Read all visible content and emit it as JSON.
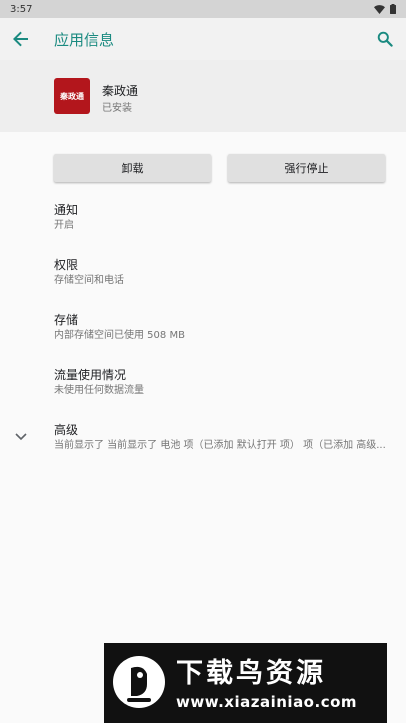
{
  "status_bar": {
    "time": "3:57"
  },
  "toolbar": {
    "title": "应用信息"
  },
  "app": {
    "icon_text": "秦政通",
    "name": "秦政通",
    "status": "已安装"
  },
  "buttons": {
    "uninstall": "卸载",
    "force_stop": "强行停止"
  },
  "prefs": [
    {
      "title": "通知",
      "summary": "开启"
    },
    {
      "title": "权限",
      "summary": "存储空间和电话"
    },
    {
      "title": "存储",
      "summary": "内部存储空间已使用 508 MB"
    },
    {
      "title": "流量使用情况",
      "summary": "未使用任何数据流量"
    },
    {
      "title": "高级",
      "summary": "当前显示了 当前显示了 电池 项（已添加 默认打开 项） 项（已添加 高级..."
    }
  ],
  "watermark": {
    "title": "下载鸟资源",
    "url": "www.xiazainiao.com"
  },
  "colors": {
    "accent": "#1a8a80",
    "app_icon_bg": "#b3161c"
  }
}
